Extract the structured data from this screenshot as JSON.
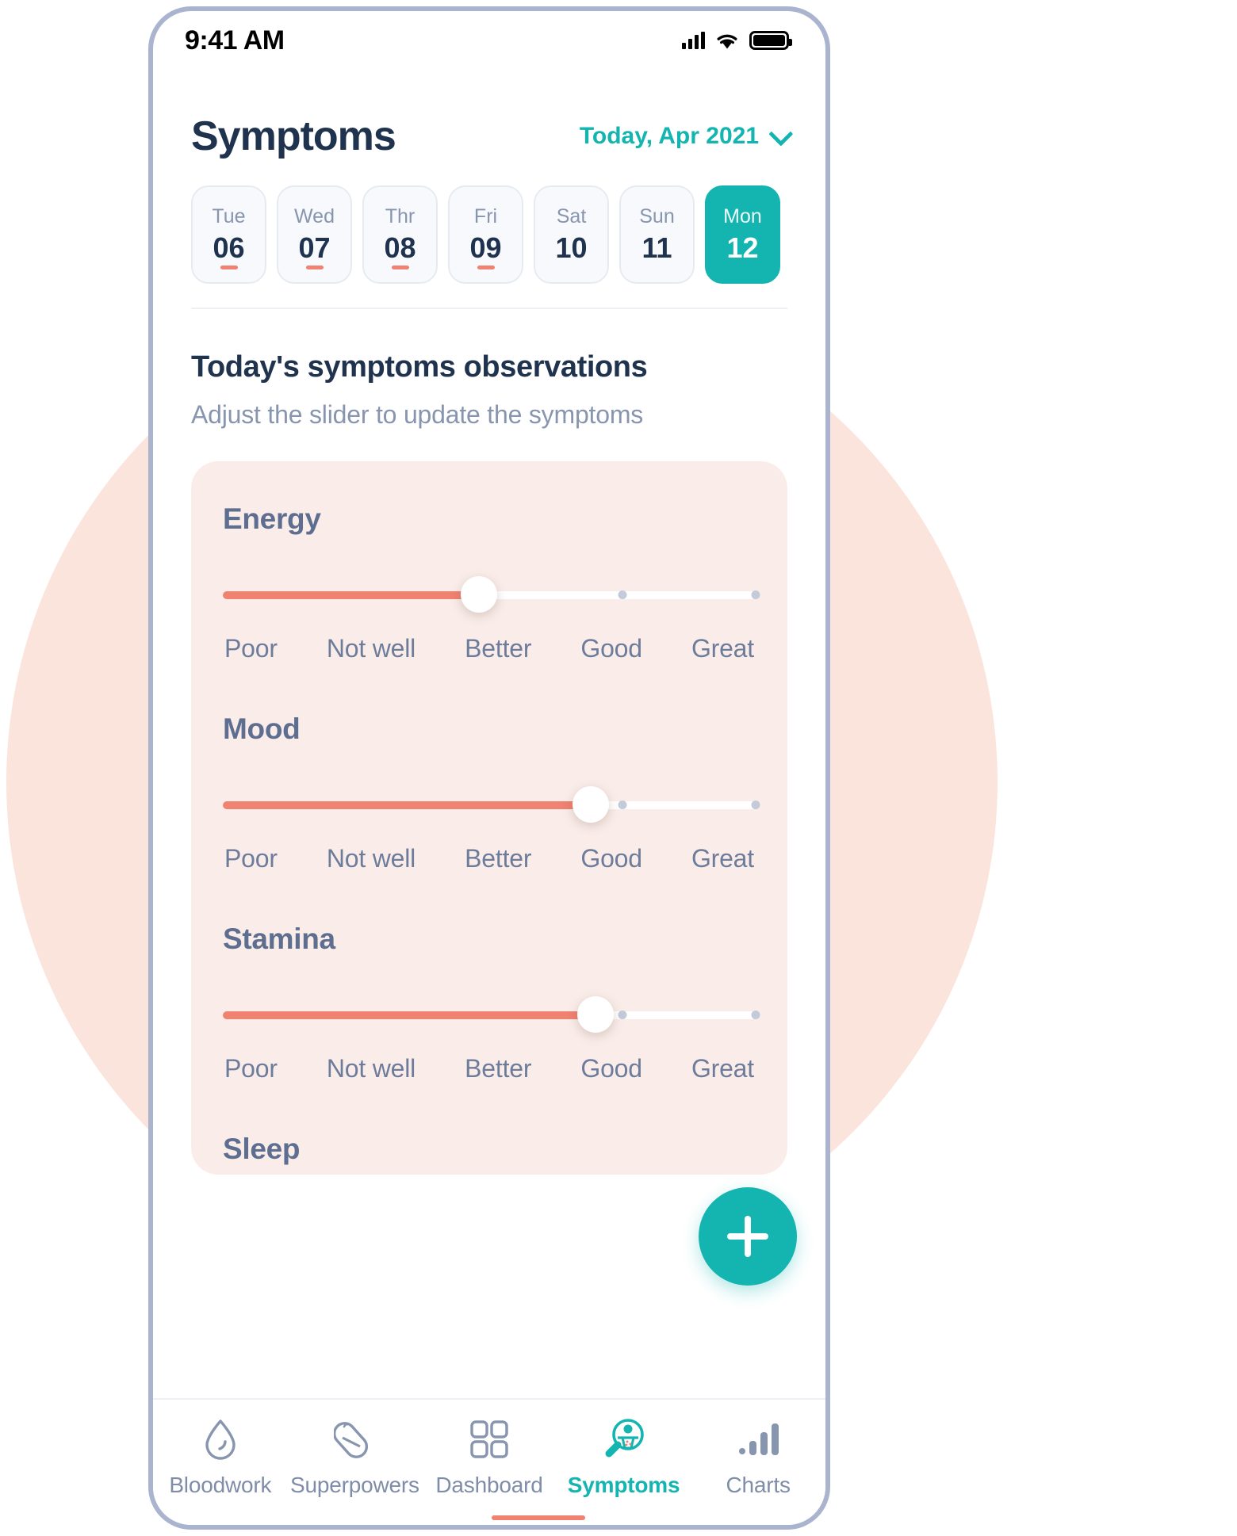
{
  "status_bar": {
    "clock": "9:41 AM",
    "signal_icon": "signal-bars-icon",
    "wifi_icon": "wifi-icon",
    "battery_icon": "battery-full-icon"
  },
  "header": {
    "title": "Symptoms",
    "date_label": "Today, Apr 2021",
    "chevron_icon": "chevron-down-icon",
    "accent_color": "#14B5B0"
  },
  "days": [
    {
      "dow": "Tue",
      "dom": "06",
      "selected": false,
      "has_dot": true
    },
    {
      "dow": "Wed",
      "dom": "07",
      "selected": false,
      "has_dot": true
    },
    {
      "dow": "Thr",
      "dom": "08",
      "selected": false,
      "has_dot": true
    },
    {
      "dow": "Fri",
      "dom": "09",
      "selected": false,
      "has_dot": true
    },
    {
      "dow": "Sat",
      "dom": "10",
      "selected": false,
      "has_dot": false
    },
    {
      "dow": "Sun",
      "dom": "11",
      "selected": false,
      "has_dot": false
    },
    {
      "dow": "Mon",
      "dom": "12",
      "selected": true,
      "has_dot": false
    }
  ],
  "main": {
    "section_title": "Today's symptoms observations",
    "section_subtitle": "Adjust the slider to update the symptoms",
    "card_color": "#FAEDE9",
    "slider_fill_color": "#F08272",
    "scale_labels": [
      "Poor",
      "Not well",
      "Better",
      "Good",
      "Great"
    ],
    "metrics": [
      {
        "name": "Energy",
        "value_label": "Better",
        "value_index": 2,
        "percent": 48
      },
      {
        "name": "Mood",
        "value_label": "Good",
        "value_index": 3,
        "percent": 69
      },
      {
        "name": "Stamina",
        "value_label": "Good",
        "value_index": 3,
        "percent": 70
      },
      {
        "name": "Sleep",
        "value_label": "",
        "value_index": null,
        "percent": null
      }
    ]
  },
  "fab": {
    "icon": "plus-icon",
    "label": "Add observation",
    "color": "#14B5B0"
  },
  "nav": {
    "items": [
      {
        "label": "Bloodwork",
        "icon": "blood-drop-icon",
        "active": false
      },
      {
        "label": "Superpowers",
        "icon": "pill-capsule-icon",
        "active": false
      },
      {
        "label": "Dashboard",
        "icon": "grid-dashboard-icon",
        "active": false
      },
      {
        "label": "Symptoms",
        "icon": "magnifier-body-icon",
        "active": true
      },
      {
        "label": "Charts",
        "icon": "bar-chart-icon",
        "active": false
      }
    ],
    "indicator_color": "#F08272"
  }
}
